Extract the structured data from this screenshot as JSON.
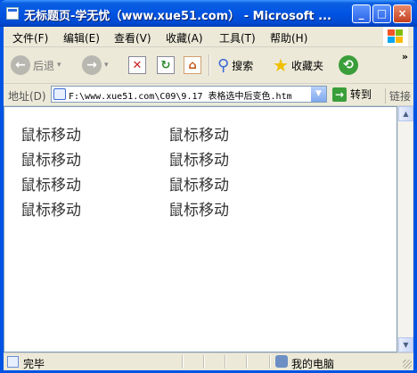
{
  "window": {
    "title": "无标题页-学无忧（www.xue51.com） - Microsoft ...",
    "min_label": "_",
    "max_label": "□",
    "close_label": "×"
  },
  "menu": [
    "文件(F)",
    "编辑(E)",
    "查看(V)",
    "收藏(A)",
    "工具(T)",
    "帮助(H)"
  ],
  "toolbar": {
    "back_label": "后退",
    "search_label": "搜索",
    "favorites_label": "收藏夹",
    "more_label": "»"
  },
  "address": {
    "label": "地址(D)",
    "value": "F:\\www.xue51.com\\C09\\9.17  表格选中后变色.htm",
    "go_label": "转到",
    "links_label": "链接"
  },
  "content": {
    "rows": [
      [
        "鼠标移动",
        "鼠标移动"
      ],
      [
        "鼠标移动",
        "鼠标移动"
      ],
      [
        "鼠标移动",
        "鼠标移动"
      ],
      [
        "鼠标移动",
        "鼠标移动"
      ]
    ]
  },
  "status": {
    "text": "完毕",
    "zone": "我的电脑"
  },
  "colors": {
    "title_blue": "#0054e3",
    "chrome": "#ece9d8",
    "content_text": "#333333"
  }
}
